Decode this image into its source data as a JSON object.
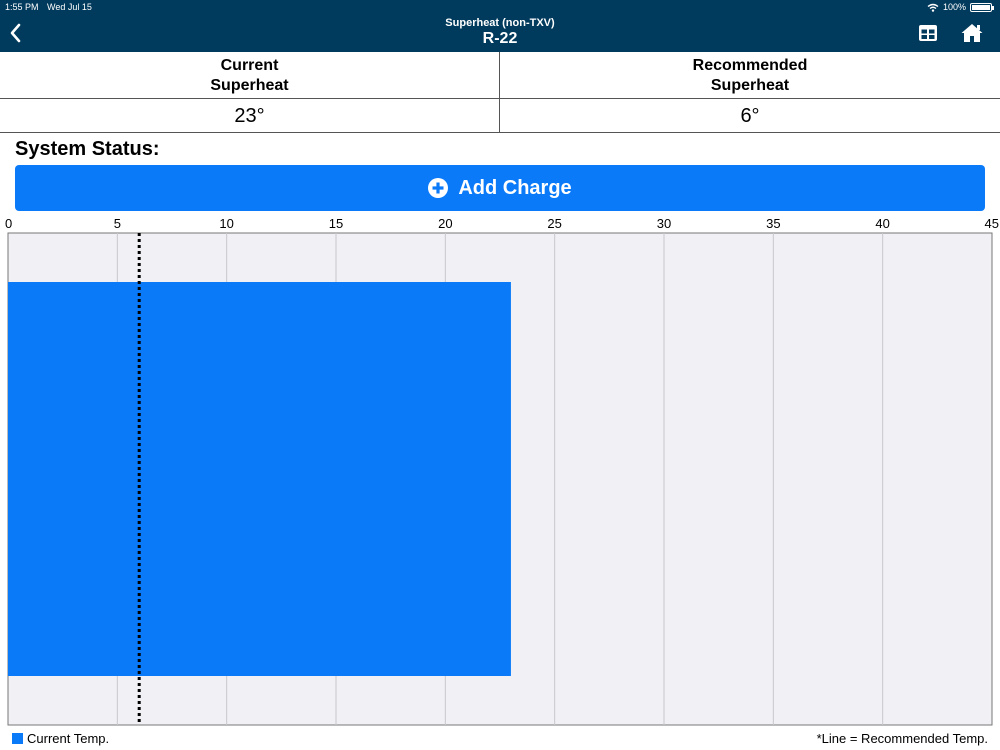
{
  "status_bar": {
    "time": "1:55 PM",
    "date": "Wed Jul 15",
    "battery": "100%"
  },
  "header": {
    "subtitle": "Superheat (non-TXV)",
    "title": "R-22"
  },
  "superheat": {
    "current": {
      "label_line1": "Current",
      "label_line2": "Superheat",
      "value": "23°"
    },
    "recommended": {
      "label_line1": "Recommended",
      "label_line2": "Superheat",
      "value": "6°"
    }
  },
  "system_status_label": "System Status:",
  "action_button": {
    "label": "Add Charge"
  },
  "colors": {
    "header_bg": "#003a5c",
    "accent": "#0a7af9",
    "plot_bg": "#f1f1f5"
  },
  "chart_data": {
    "type": "bar",
    "orientation": "horizontal",
    "xlim": [
      0,
      45
    ],
    "xticks": [
      0,
      5,
      10,
      15,
      20,
      25,
      30,
      35,
      40,
      45
    ],
    "tick_labels": [
      "0",
      "5",
      "10",
      "15",
      "20",
      "25",
      "30",
      "35",
      "40",
      "45"
    ],
    "series": [
      {
        "name": "Current Temp.",
        "values": [
          23
        ]
      }
    ],
    "reference_line": {
      "value": 6,
      "style": "dotted"
    },
    "grid": true
  },
  "legend": {
    "current_label": "Current Temp.",
    "note": "*Line = Recommended Temp."
  }
}
